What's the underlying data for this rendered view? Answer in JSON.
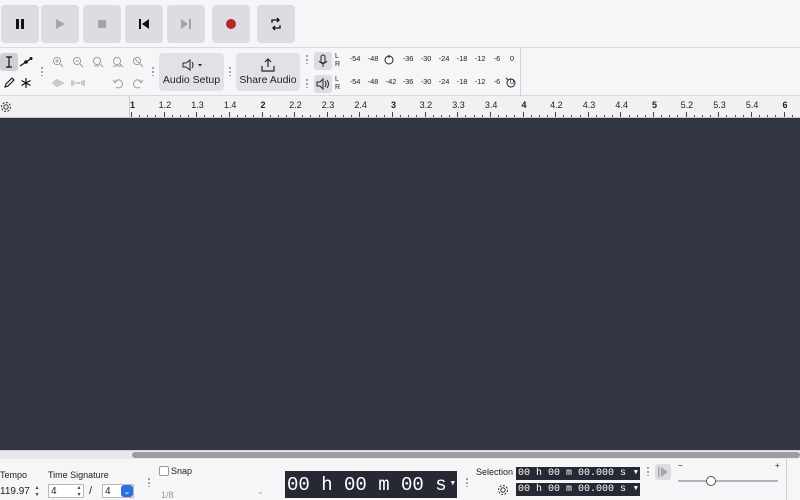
{
  "transport": {
    "buttons": [
      {
        "name": "pause-button",
        "icon": "pause-icon"
      },
      {
        "name": "play-button",
        "icon": "play-icon"
      },
      {
        "name": "stop-button",
        "icon": "stop-icon"
      },
      {
        "name": "skip-to-start-button",
        "icon": "skip-to-start-icon"
      },
      {
        "name": "skip-to-end-button",
        "icon": "skip-to-end-icon"
      },
      {
        "name": "record-button",
        "icon": "record-icon"
      },
      {
        "name": "loop-button",
        "icon": "loop-icon"
      }
    ],
    "record_color": "#b3262b"
  },
  "toolbar": {
    "audio_setup_label": "Audio Setup",
    "share_audio_label": "Share Audio",
    "meter_lr": [
      "L",
      "R"
    ],
    "record_scale": [
      "-54",
      "-48",
      "-36",
      "-30",
      "-24",
      "-18",
      "-12",
      "-6",
      "0"
    ],
    "playback_scale": [
      "-54",
      "-48",
      "-42",
      "-36",
      "-30",
      "-24",
      "-18",
      "-12",
      "-6",
      "0"
    ]
  },
  "ruler": {
    "ticks": [
      "1",
      "1.2",
      "1.3",
      "1.4",
      "2",
      "2.2",
      "2.3",
      "2.4",
      "3",
      "3.2",
      "3.3",
      "3.4",
      "4",
      "4.2",
      "4.3",
      "4.4",
      "5",
      "5.2",
      "5.3",
      "5.4",
      "6"
    ],
    "major": [
      "1",
      "2",
      "3",
      "4",
      "5",
      "6"
    ]
  },
  "bottom": {
    "tempo_label": "Tempo",
    "tempo_value": "119.97",
    "time_signature_label": "Time Signature",
    "ts_numerator": "4",
    "ts_separator": "/",
    "ts_denominator": "4",
    "snap_label": "Snap",
    "snap_value": "1/8",
    "time_display": "00 h 00 m 00 s",
    "selection_label": "Selection",
    "selection_start": "00 h 00 m 00.000 s",
    "selection_end": "00 h 00 m 00.000 s",
    "slider_min": "−",
    "slider_max": "+",
    "track_background": "#323542"
  }
}
